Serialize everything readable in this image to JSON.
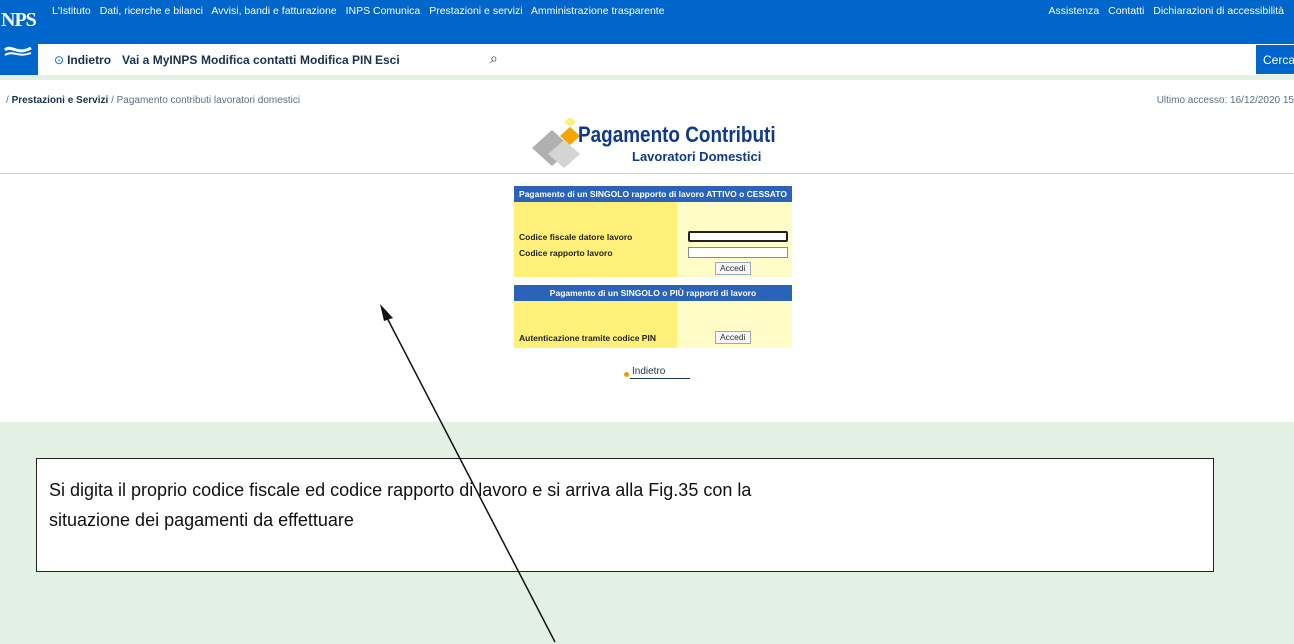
{
  "header": {
    "logo_text": "NPS",
    "top_links": [
      "L'Istituto",
      "Dati, ricerche e bilanci",
      "Avvisi, bandi e fatturazione",
      "INPS Comunica",
      "Prestazioni e servizi",
      "Amministrazione trasparente"
    ],
    "right_links": [
      "Assistenza",
      "Contatti",
      "Dichiarazioni di accessibilità"
    ]
  },
  "nav": {
    "back_label": "Indietro",
    "myinps_label": "Vai a MyINPS",
    "contacts_label": "Modifica contatti",
    "pin_label": "Modifica PIN",
    "exit_label": "Esci",
    "search_button": "Cerca"
  },
  "breadcrumb": {
    "sep": "/",
    "section": "Prestazioni e Servizi",
    "current": "Pagamento contributi lavoratori domestici"
  },
  "last_access": "Ultimo accesso: 16/12/2020 15",
  "banner": {
    "title": "Pagamento Contributi",
    "subtitle": "Lavoratori Domestici"
  },
  "form": {
    "section1_title": "Pagamento di un SINGOLO rapporto di lavoro ATTIVO o CESSATO",
    "cf_label": "Codice fiscale datore lavoro",
    "code_label": "Codice rapporto lavoro",
    "accedi1": "Accedi",
    "section2_title": "Pagamento di un SINGOLO o PIÙ rapporti di lavoro",
    "pin_label": "Autenticazione tramite codice PIN",
    "accedi2": "Accedi",
    "back_link": "Indietro"
  },
  "annotation": {
    "line1": "Si digita il proprio codice fiscale ed codice rapporto di lavoro  e si arriva alla Fig.35 con la",
    "line2": "situazione dei pagamenti da effettuare"
  },
  "colors": {
    "brand_blue": "#0066cc",
    "form_header": "#2a63b8",
    "label_yellow": "#fff07a",
    "page_border_green": "#e3f0e4"
  }
}
